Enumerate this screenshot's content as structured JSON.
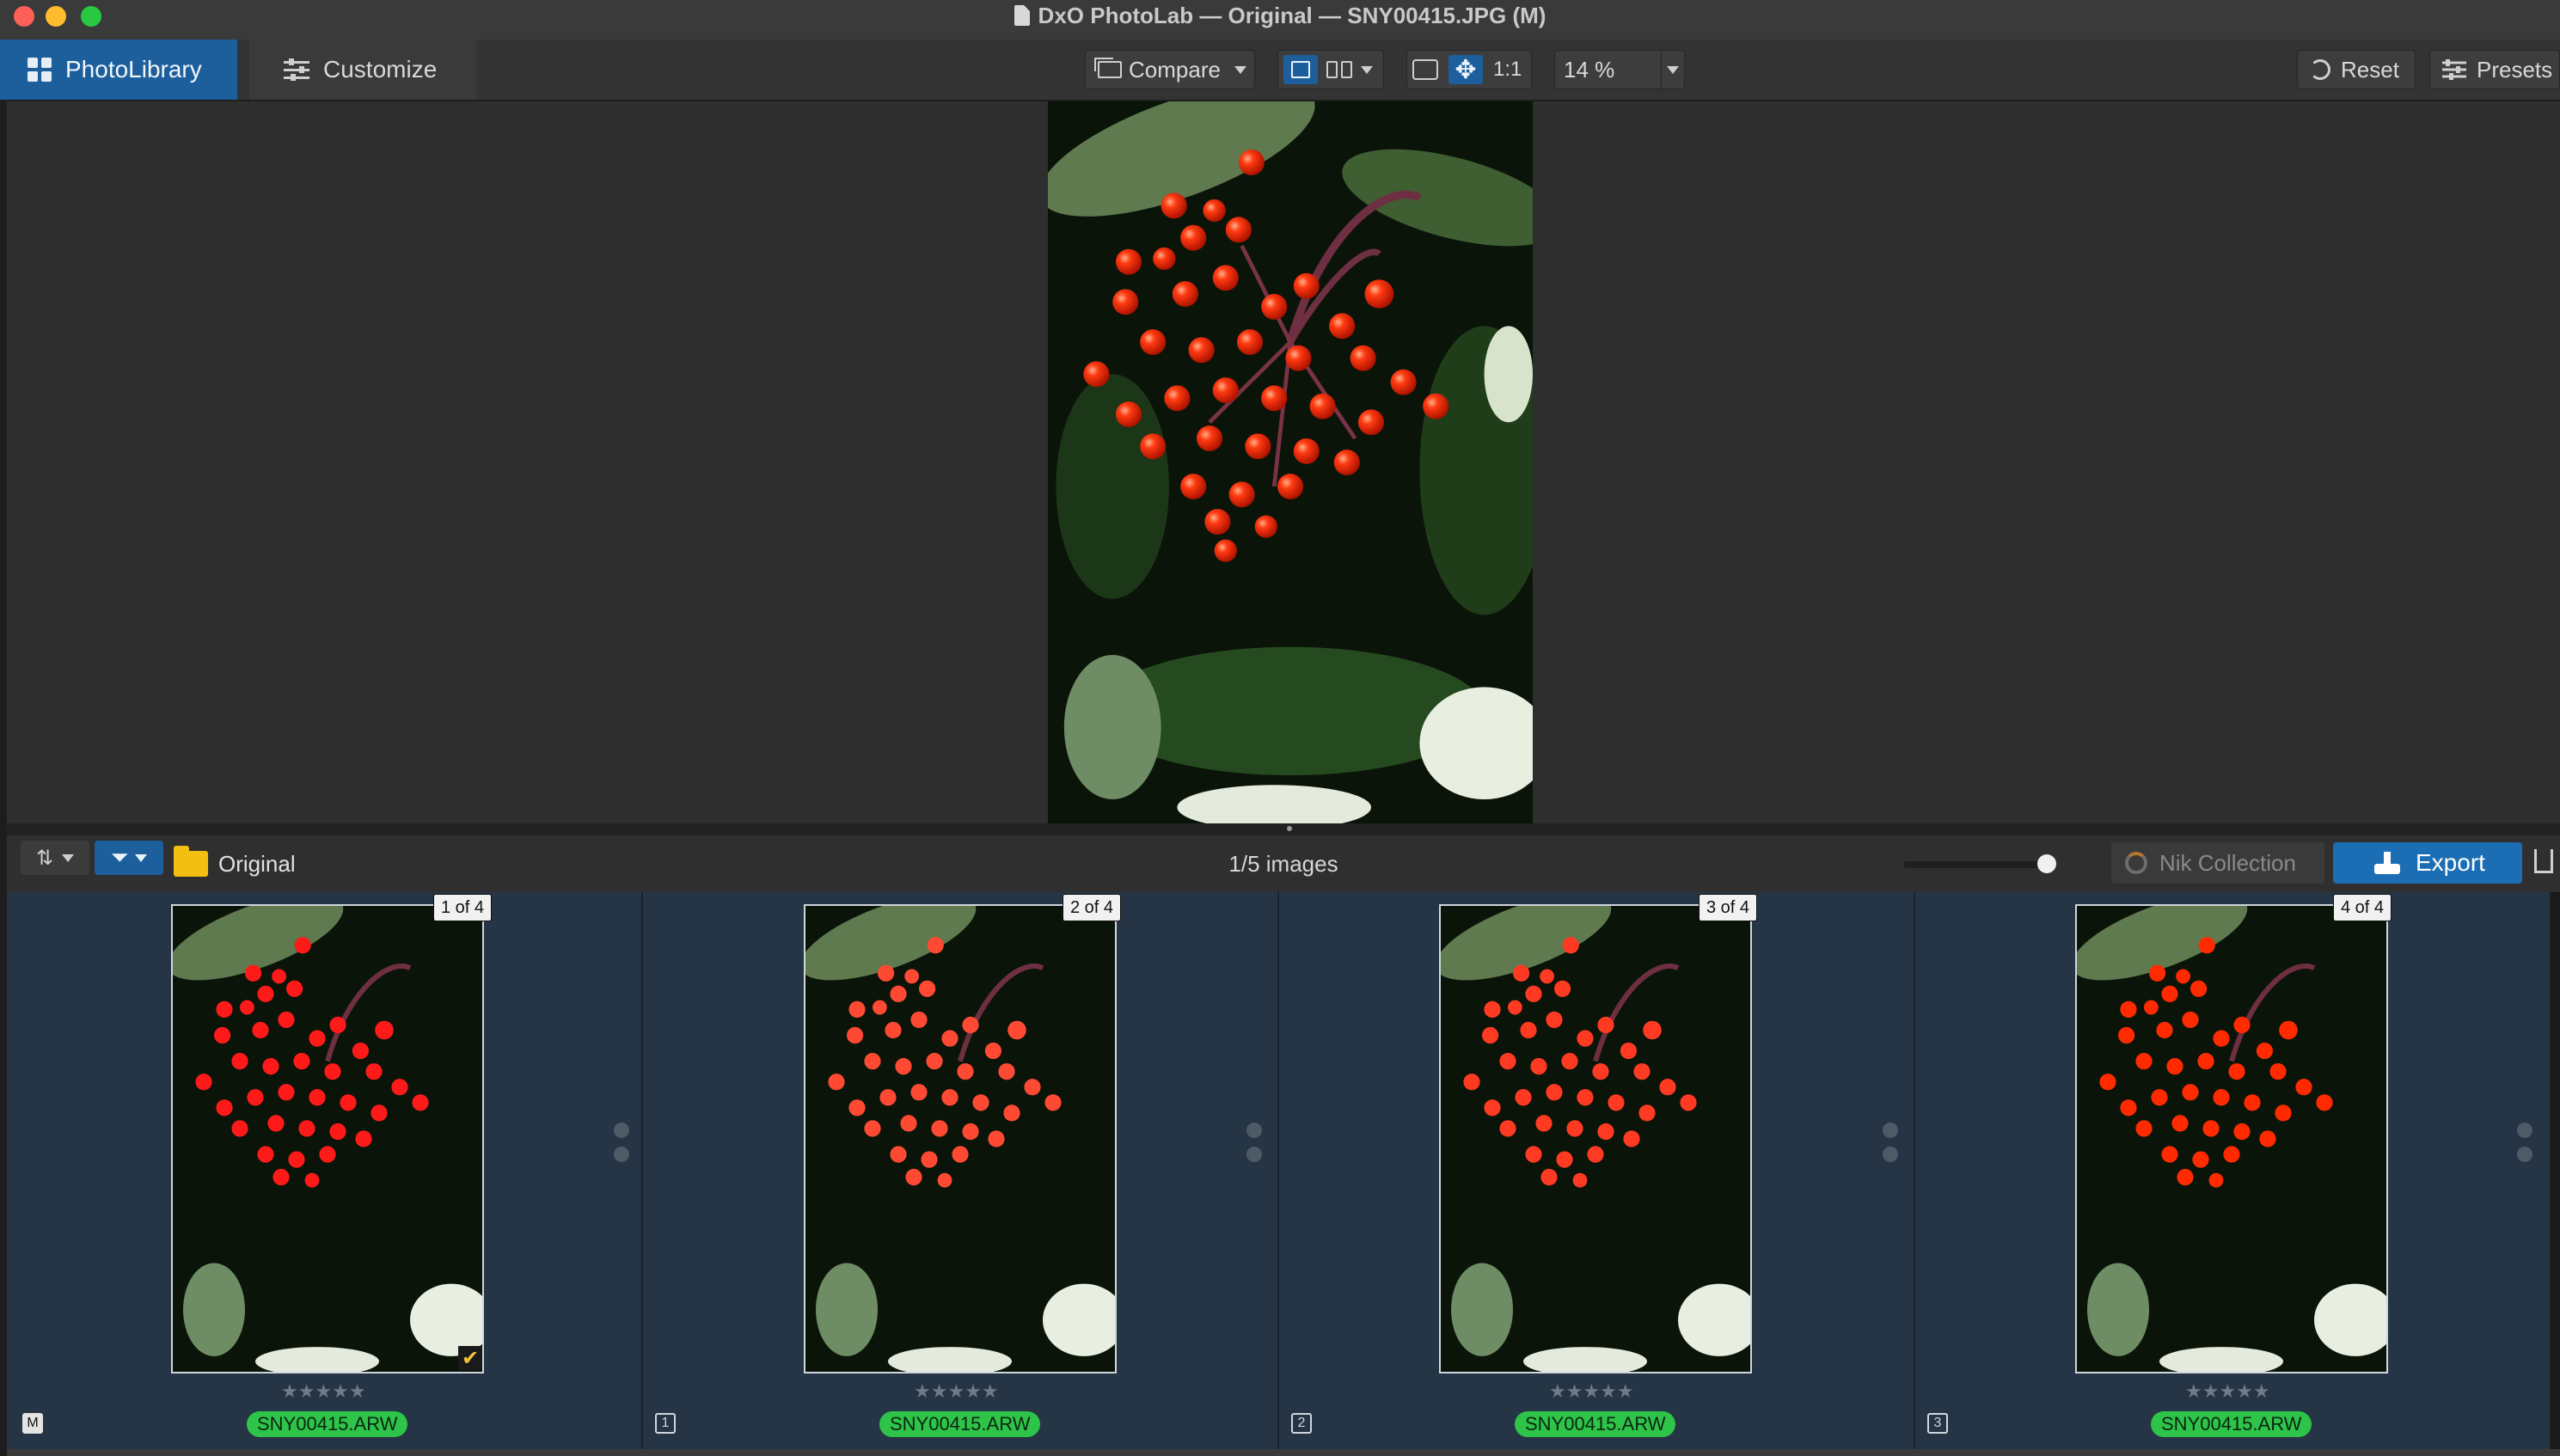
{
  "window": {
    "title": "DxO PhotoLab — Original — SNY00415.JPG (M)"
  },
  "toolbar": {
    "photolibrary_label": "PhotoLibrary",
    "customize_label": "Customize",
    "compare_label": "Compare",
    "one_to_one_label": "1:1",
    "zoom_value": "14 %",
    "reset_label": "Reset",
    "presets_label": "Presets"
  },
  "browser": {
    "folder_label": "Original",
    "image_count": "1/5 images",
    "nik_label": "Nik Collection",
    "export_label": "Export"
  },
  "thumbnails": [
    {
      "index": "1 of 4",
      "name": "SNY00415.ARW",
      "vc": "M",
      "selected": true,
      "stars": "★★★★★"
    },
    {
      "index": "2 of 4",
      "name": "SNY00415.ARW",
      "vc": "1",
      "selected": false,
      "stars": "★★★★★"
    },
    {
      "index": "3 of 4",
      "name": "SNY00415.ARW",
      "vc": "2",
      "selected": false,
      "stars": "★★★★★"
    },
    {
      "index": "4 of 4",
      "name": "SNY00415.ARW",
      "vc": "3",
      "selected": false,
      "stars": "★★★★★"
    }
  ],
  "colors": {
    "accent": "#1c5f9c",
    "export": "#1c6eb4",
    "name_badge": "#2ec44a",
    "filmstrip_cell": "#253545",
    "berry_red": "#ff2a00"
  },
  "icons": [
    "photolibrary-grid-icon",
    "customize-sliders-icon",
    "compare-icon",
    "single-view-icon",
    "split-view-icon",
    "fit-icon",
    "move-icon",
    "reset-icon",
    "presets-icon",
    "sort-icon",
    "filter-icon",
    "folder-icon",
    "nik-icon",
    "export-icon",
    "share-icon",
    "checkmark-icon"
  ]
}
